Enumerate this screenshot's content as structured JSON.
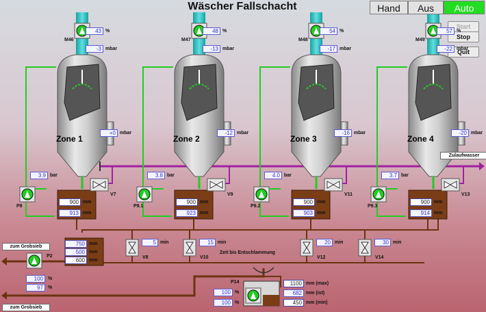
{
  "title": "Wäscher Fallschacht",
  "modes": [
    {
      "label": "Hand",
      "active": false
    },
    {
      "label": "Aus",
      "active": false
    },
    {
      "label": "Auto",
      "active": true
    }
  ],
  "controls": {
    "start": "Start",
    "stop": "Stop",
    "quit": "Quit"
  },
  "zones": [
    {
      "name": "Zone 1",
      "fan": "M46",
      "fan_pct": "43",
      "fan_pressure": "-3",
      "zone_pressure": "+0",
      "line_pressure": "3.9",
      "pump": "P8",
      "valve": "V7",
      "tank_top": "900",
      "tank_level": "913"
    },
    {
      "name": "Zone 2",
      "fan": "M47",
      "fan_pct": "48",
      "fan_pressure": "-13",
      "zone_pressure": "-12",
      "line_pressure": "3.8",
      "pump": "P9.1",
      "valve": "V9",
      "tank_top": "900",
      "tank_level": "923"
    },
    {
      "name": "Zone 3",
      "fan": "M48",
      "fan_pct": "54",
      "fan_pressure": "-17",
      "zone_pressure": "-16",
      "line_pressure": "4.0",
      "pump": "P9.2",
      "valve": "V11",
      "tank_top": "900",
      "tank_level": "903"
    },
    {
      "name": "Zone 4",
      "fan": "M49",
      "fan_pct": "57",
      "fan_pressure": "-22",
      "zone_pressure": "-20",
      "line_pressure": "3.7",
      "pump": "P9.3",
      "valve": "V13",
      "tank_top": "900",
      "tank_level": "914"
    }
  ],
  "units": {
    "pct": "%",
    "mbar": "mbar",
    "bar": "bar",
    "mm": "mm",
    "min": "min"
  },
  "drain_valves": [
    {
      "name": "V8",
      "min": "5"
    },
    {
      "name": "V10",
      "min": "15"
    },
    {
      "name": "V12",
      "min": "20"
    },
    {
      "name": "V14",
      "min": "30"
    }
  ],
  "zeit_label": "Zeit bis Entschlammung",
  "zulauf_label": "Zulaufwasser",
  "grobsieb_label": "zum Grobsieb",
  "left_tank": {
    "levels": [
      "750",
      "500",
      "600"
    ],
    "pump": "P2",
    "pct1": "100",
    "pct2": "97"
  },
  "p14": {
    "name": "P14",
    "pct1": "100",
    "pct2": "100",
    "max": "1100",
    "ist": "682",
    "min": "450",
    "max_label": "mm (max)",
    "ist_label": "mm (ist)",
    "min_label": "mm (min)"
  }
}
